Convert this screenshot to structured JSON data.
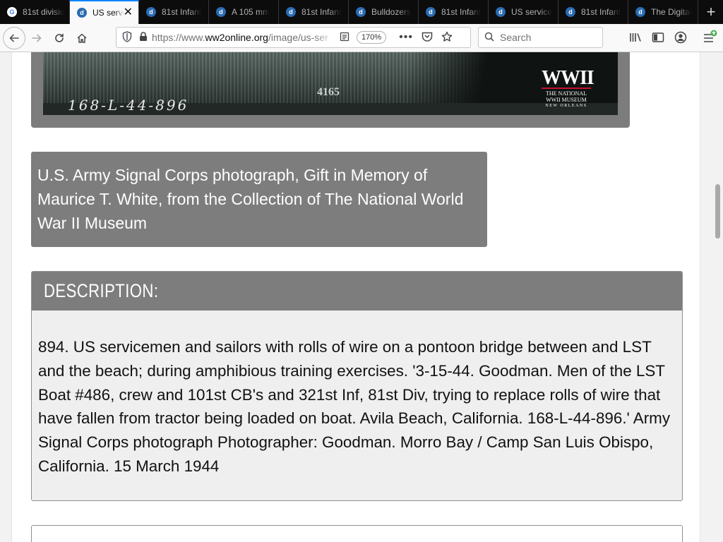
{
  "tabs": [
    {
      "label": "81st divisio",
      "icon": "google-icon",
      "active": false
    },
    {
      "label": "US servi",
      "icon": "drupal-icon",
      "active": true
    },
    {
      "label": "81st Infant",
      "icon": "drupal-icon",
      "active": false
    },
    {
      "label": "A 105 mm",
      "icon": "drupal-icon",
      "active": false
    },
    {
      "label": "81st Infant",
      "icon": "drupal-icon",
      "active": false
    },
    {
      "label": "Bulldozers",
      "icon": "drupal-icon",
      "active": false
    },
    {
      "label": "81st Infant",
      "icon": "drupal-icon",
      "active": false
    },
    {
      "label": "US service",
      "icon": "drupal-icon",
      "active": false
    },
    {
      "label": "81st Infant",
      "icon": "drupal-icon",
      "active": false
    },
    {
      "label": "The Digital",
      "icon": "drupal-icon",
      "active": false
    }
  ],
  "toolbar": {
    "url_prefix": "https://www.",
    "url_domain": "ww2online.org",
    "url_path": "/image/us-ser",
    "zoom": "170%",
    "search_placeholder": "Search"
  },
  "photo": {
    "plate_number": "4165",
    "handwritten_caption": "168-L-44-896",
    "logo": {
      "mark": "WWII",
      "line1": "THE NATIONAL",
      "line2": "WWII MUSEUM",
      "line3": "NEW ORLEANS"
    }
  },
  "credit": "U.S. Army Signal Corps photograph, Gift in Memory of Maurice T. White, from the Collection of The National World War II Museum",
  "description": {
    "heading": "DESCRIPTION:",
    "body": "894. US servicemen and sailors with rolls of wire on a pontoon bridge between and LST and the beach; during amphibious training exercises. '3-15-44. Goodman. Men of the LST Boat #486, crew and 101st CB's and 321st Inf, 81st Div, trying to replace rolls of wire that have fallen from tractor being loaded on boat. Avila Beach, California. 168-L-44-896.' Army Signal Corps photograph Photographer: Goodman. Morro Bay / Camp San Luis Obispo, California. 15 March 1944"
  },
  "colors": {
    "accent": "#0a84ff",
    "panel_gray": "#7d7d7d",
    "description_bg": "#efefef"
  }
}
